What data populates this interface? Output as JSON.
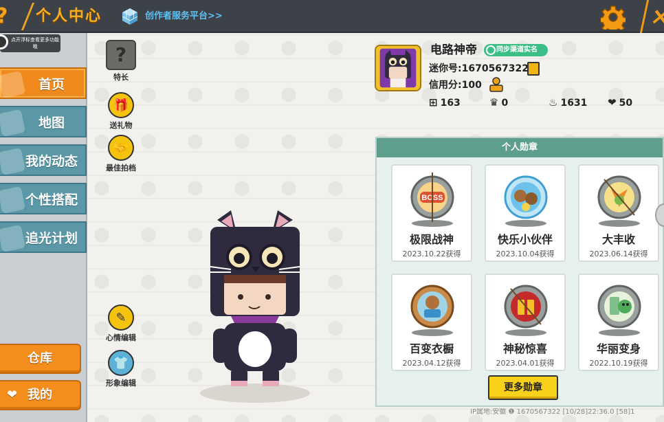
{
  "header": {
    "help_icon": "?",
    "title": "个人中心",
    "platform_link": "创作者服务平台>>",
    "close_glyph": "×"
  },
  "hint": {
    "text": "点开浮标查看更多功能哦"
  },
  "sidebar": {
    "items": [
      {
        "label": "首页",
        "active": true,
        "icon": "home-icon"
      },
      {
        "label": "地图",
        "active": false,
        "icon": "map-icon"
      },
      {
        "label": "我的动态",
        "active": false,
        "icon": "feed-icon"
      },
      {
        "label": "个性搭配",
        "active": false,
        "icon": "outfit-icon"
      },
      {
        "label": "追光计划",
        "active": false,
        "icon": "spotlight-icon"
      }
    ],
    "warehouse_label": "仓库",
    "mine_label": "我的"
  },
  "functions": {
    "specialty_label": "特长",
    "gift_label": "送礼物",
    "partner_label": "最佳拍档",
    "mood_label": "心情编辑",
    "appearance_label": "形象编辑"
  },
  "profile": {
    "name": "电路神帝",
    "verify_badge": "同步渠道实名",
    "mini_id": "迷你号:1670567322",
    "credit": "信用分:100",
    "stats": [
      {
        "icon": "plus-square-icon",
        "value": "163"
      },
      {
        "icon": "trophy-icon",
        "value": "0"
      },
      {
        "icon": "flame-icon",
        "value": "1631"
      },
      {
        "icon": "heart-icon",
        "value": "50"
      }
    ]
  },
  "medals": {
    "title": "个人勋章",
    "items": [
      {
        "name": "极限战神",
        "date": "2023.10.22获得",
        "icon": "boss-medal-icon"
      },
      {
        "name": "快乐小伙伴",
        "date": "2023.10.04获得",
        "icon": "friends-medal-icon"
      },
      {
        "name": "大丰收",
        "date": "2023.06.14获得",
        "icon": "harvest-medal-icon"
      },
      {
        "name": "百变衣橱",
        "date": "2023.04.12获得",
        "icon": "wardrobe-medal-icon"
      },
      {
        "name": "神秘惊喜",
        "date": "2023.04.01获得",
        "icon": "gift-medal-icon"
      },
      {
        "name": "华丽变身",
        "date": "2022.10.19获得",
        "icon": "transform-medal-icon"
      }
    ],
    "more_label": "更多勋章"
  },
  "footer": {
    "text": "IP属地:安徽 ❶    1670567322   [10/28]22:36.0 [58]1"
  },
  "colors": {
    "accent_orange": "#f08a1c",
    "nav_teal": "#5a98a8",
    "topbar": "#3c4248",
    "panel_head": "#5e9e8c",
    "more_button": "#f8d21a"
  }
}
